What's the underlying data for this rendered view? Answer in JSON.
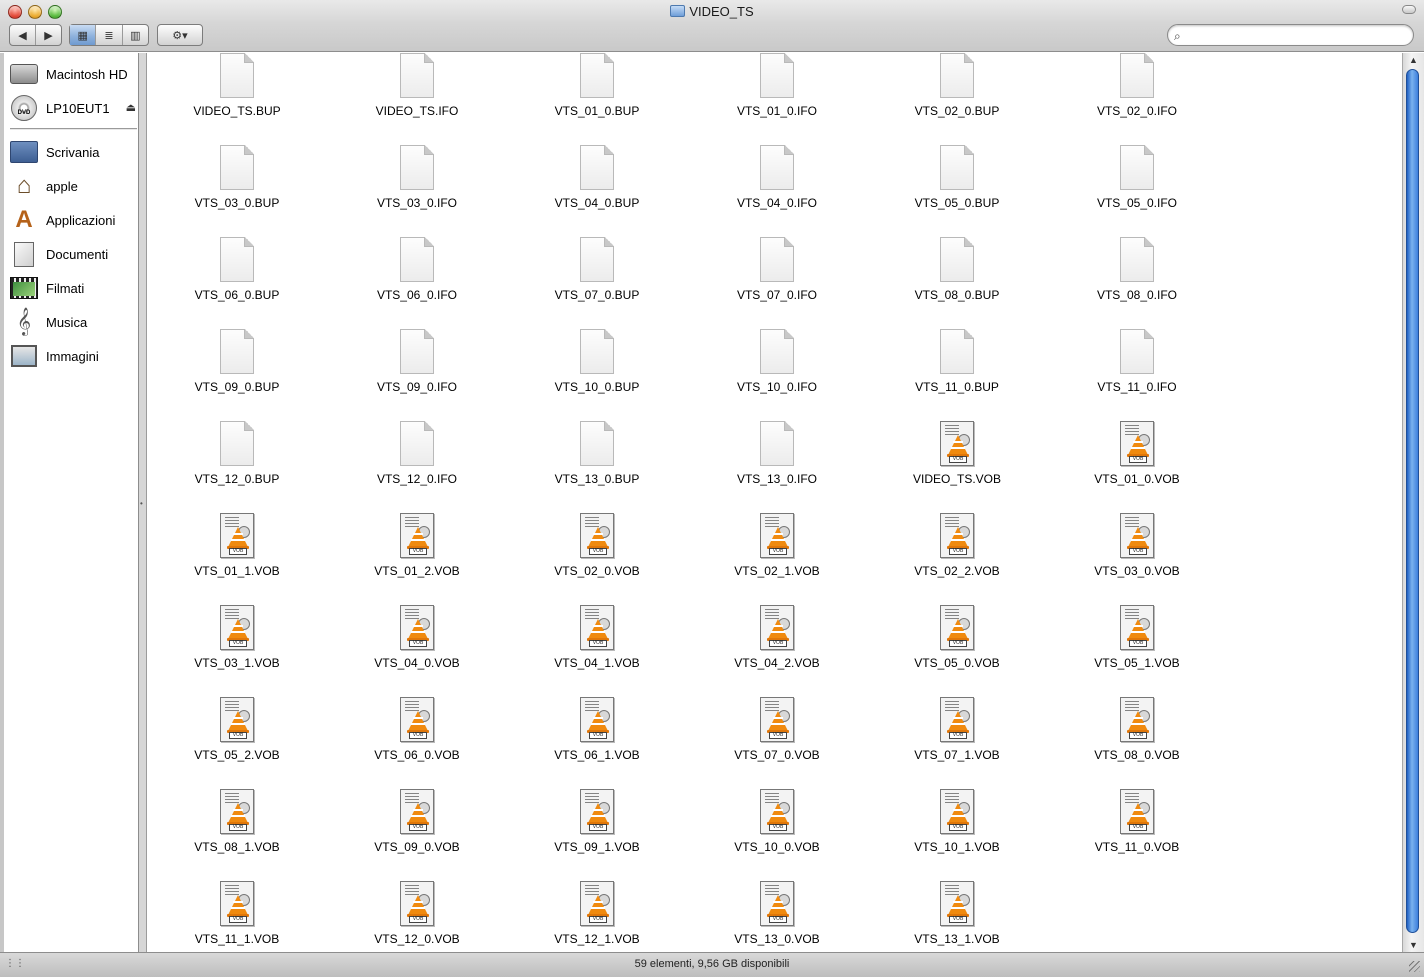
{
  "window": {
    "title": "VIDEO_TS"
  },
  "toolbar": {
    "back_glyph": "◀",
    "forward_glyph": "▶",
    "view_icon_glyph": "▦",
    "view_list_glyph": "≣",
    "view_column_glyph": "▥",
    "action_glyph": "⚙▾",
    "search_value": "",
    "search_placeholder": ""
  },
  "sidebar": {
    "devices": [
      {
        "label": "Macintosh HD",
        "icon": "hard-drive-icon"
      },
      {
        "label": "LP10EUT1",
        "icon": "dvd-disc-icon",
        "eject": "⏏"
      }
    ],
    "places": [
      {
        "label": "Scrivania",
        "icon": "desktop-icon"
      },
      {
        "label": "apple",
        "icon": "home-icon"
      },
      {
        "label": "Applicazioni",
        "icon": "applications-icon"
      },
      {
        "label": "Documenti",
        "icon": "documents-icon"
      },
      {
        "label": "Filmati",
        "icon": "movies-icon"
      },
      {
        "label": "Musica",
        "icon": "music-icon"
      },
      {
        "label": "Immagini",
        "icon": "pictures-icon"
      }
    ]
  },
  "files": [
    {
      "name": "VIDEO_TS.BUP",
      "type": "generic"
    },
    {
      "name": "VIDEO_TS.IFO",
      "type": "generic"
    },
    {
      "name": "VTS_01_0.BUP",
      "type": "generic"
    },
    {
      "name": "VTS_01_0.IFO",
      "type": "generic"
    },
    {
      "name": "VTS_02_0.BUP",
      "type": "generic"
    },
    {
      "name": "VTS_02_0.IFO",
      "type": "generic"
    },
    {
      "name": "VTS_03_0.BUP",
      "type": "generic"
    },
    {
      "name": "VTS_03_0.IFO",
      "type": "generic"
    },
    {
      "name": "VTS_04_0.BUP",
      "type": "generic"
    },
    {
      "name": "VTS_04_0.IFO",
      "type": "generic"
    },
    {
      "name": "VTS_05_0.BUP",
      "type": "generic"
    },
    {
      "name": "VTS_05_0.IFO",
      "type": "generic"
    },
    {
      "name": "VTS_06_0.BUP",
      "type": "generic"
    },
    {
      "name": "VTS_06_0.IFO",
      "type": "generic"
    },
    {
      "name": "VTS_07_0.BUP",
      "type": "generic"
    },
    {
      "name": "VTS_07_0.IFO",
      "type": "generic"
    },
    {
      "name": "VTS_08_0.BUP",
      "type": "generic"
    },
    {
      "name": "VTS_08_0.IFO",
      "type": "generic"
    },
    {
      "name": "VTS_09_0.BUP",
      "type": "generic"
    },
    {
      "name": "VTS_09_0.IFO",
      "type": "generic"
    },
    {
      "name": "VTS_10_0.BUP",
      "type": "generic"
    },
    {
      "name": "VTS_10_0.IFO",
      "type": "generic"
    },
    {
      "name": "VTS_11_0.BUP",
      "type": "generic"
    },
    {
      "name": "VTS_11_0.IFO",
      "type": "generic"
    },
    {
      "name": "VTS_12_0.BUP",
      "type": "generic"
    },
    {
      "name": "VTS_12_0.IFO",
      "type": "generic"
    },
    {
      "name": "VTS_13_0.BUP",
      "type": "generic"
    },
    {
      "name": "VTS_13_0.IFO",
      "type": "generic"
    },
    {
      "name": "VIDEO_TS.VOB",
      "type": "vob"
    },
    {
      "name": "VTS_01_0.VOB",
      "type": "vob"
    },
    {
      "name": "VTS_01_1.VOB",
      "type": "vob"
    },
    {
      "name": "VTS_01_2.VOB",
      "type": "vob"
    },
    {
      "name": "VTS_02_0.VOB",
      "type": "vob"
    },
    {
      "name": "VTS_02_1.VOB",
      "type": "vob"
    },
    {
      "name": "VTS_02_2.VOB",
      "type": "vob"
    },
    {
      "name": "VTS_03_0.VOB",
      "type": "vob"
    },
    {
      "name": "VTS_03_1.VOB",
      "type": "vob"
    },
    {
      "name": "VTS_04_0.VOB",
      "type": "vob"
    },
    {
      "name": "VTS_04_1.VOB",
      "type": "vob"
    },
    {
      "name": "VTS_04_2.VOB",
      "type": "vob"
    },
    {
      "name": "VTS_05_0.VOB",
      "type": "vob"
    },
    {
      "name": "VTS_05_1.VOB",
      "type": "vob"
    },
    {
      "name": "VTS_05_2.VOB",
      "type": "vob"
    },
    {
      "name": "VTS_06_0.VOB",
      "type": "vob"
    },
    {
      "name": "VTS_06_1.VOB",
      "type": "vob"
    },
    {
      "name": "VTS_07_0.VOB",
      "type": "vob"
    },
    {
      "name": "VTS_07_1.VOB",
      "type": "vob"
    },
    {
      "name": "VTS_08_0.VOB",
      "type": "vob"
    },
    {
      "name": "VTS_08_1.VOB",
      "type": "vob"
    },
    {
      "name": "VTS_09_0.VOB",
      "type": "vob"
    },
    {
      "name": "VTS_09_1.VOB",
      "type": "vob"
    },
    {
      "name": "VTS_10_0.VOB",
      "type": "vob"
    },
    {
      "name": "VTS_10_1.VOB",
      "type": "vob"
    },
    {
      "name": "VTS_11_0.VOB",
      "type": "vob"
    },
    {
      "name": "VTS_11_1.VOB",
      "type": "vob"
    },
    {
      "name": "VTS_12_0.VOB",
      "type": "vob"
    },
    {
      "name": "VTS_12_1.VOB",
      "type": "vob"
    },
    {
      "name": "VTS_13_0.VOB",
      "type": "vob"
    },
    {
      "name": "VTS_13_1.VOB",
      "type": "vob"
    }
  ],
  "vob_tag": "VOB",
  "status": {
    "text": "59 elementi, 9,56 GB disponibili"
  },
  "colors": {
    "selection_blue": "#6f9ad0",
    "scroll_thumb": "#3c7fdc",
    "vlc_orange": "#f08a0f"
  }
}
